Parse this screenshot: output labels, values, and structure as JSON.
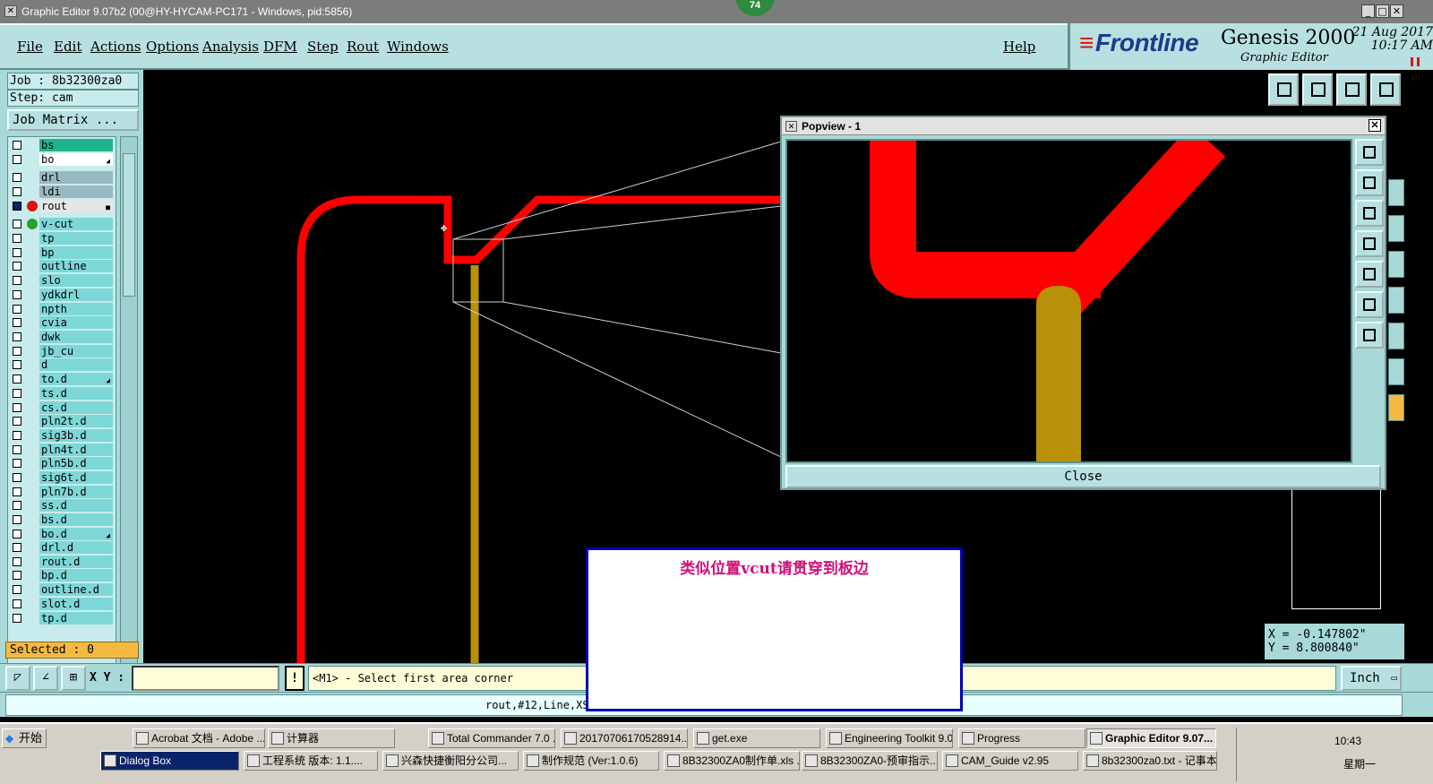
{
  "window": {
    "title": "Graphic Editor 9.07b2 (00@HY-HYCAM-PC171 - Windows, pid:5856)",
    "badge": "74"
  },
  "menu": {
    "items": [
      "File",
      "Edit",
      "Actions",
      "Options",
      "Analysis",
      "DFM",
      "Step",
      "Rout",
      "Windows"
    ],
    "help": "Help"
  },
  "brand": {
    "logo": "Frontline",
    "product": "Genesis 2000",
    "subtitle": "Graphic Editor",
    "date": "21 Aug 2017",
    "time": "10:17 AM"
  },
  "left": {
    "job": "Job : 8b32300za0",
    "step": "Step: cam",
    "job_matrix": "Job Matrix ...",
    "selected": "Selected : 0",
    "layers": [
      {
        "name": "bs",
        "color": "#1fb38a"
      },
      {
        "name": "bo",
        "color": "#ffffff",
        "mark": "◢"
      },
      {
        "name": "drl",
        "color": "#9ab8c0"
      },
      {
        "name": "ldi",
        "color": "#9ab8c0"
      },
      {
        "name": "rout",
        "color": "#e6e6e6",
        "dot": "#e01010",
        "active": true,
        "mark": "■"
      },
      {
        "name": "v-cut",
        "dot": "#2aa02a"
      },
      {
        "name": "tp"
      },
      {
        "name": "bp"
      },
      {
        "name": "outline"
      },
      {
        "name": "slo"
      },
      {
        "name": "ydkdrl"
      },
      {
        "name": "npth"
      },
      {
        "name": "cvia"
      },
      {
        "name": "dwk"
      },
      {
        "name": "jb_cu"
      },
      {
        "name": "d"
      },
      {
        "name": "to.d",
        "mark": "◢"
      },
      {
        "name": "ts.d"
      },
      {
        "name": "cs.d"
      },
      {
        "name": "pln2t.d"
      },
      {
        "name": "sig3b.d"
      },
      {
        "name": "pln4t.d"
      },
      {
        "name": "pln5b.d"
      },
      {
        "name": "sig6t.d"
      },
      {
        "name": "pln7b.d"
      },
      {
        "name": "ss.d"
      },
      {
        "name": "bs.d"
      },
      {
        "name": "bo.d",
        "mark": "◢"
      },
      {
        "name": "drl.d"
      },
      {
        "name": "rout.d"
      },
      {
        "name": "bp.d"
      },
      {
        "name": "outline.d"
      },
      {
        "name": "slot.d"
      },
      {
        "name": "tp.d"
      }
    ]
  },
  "popview": {
    "title": "Popview - 1",
    "close_label": "Close"
  },
  "coords": {
    "x": "X = -0.147802\"",
    "y": "Y = 8.800840\""
  },
  "bottom": {
    "xy_label": "X Y :",
    "xy_value": "",
    "prompt": "<M1> - Select first area corner",
    "unit": "Inch",
    "status": "rout,#12,Line,XS="
  },
  "note": {
    "text": "类似位置vcut请贯穿到板边"
  },
  "colors": {
    "rout": "#ff0000",
    "vcut": "#b8900a",
    "panel": "#a8d8d8",
    "layer_label": "#7ed7d7"
  },
  "taskbar": {
    "start": "开始",
    "row1": [
      "Acrobat 文档 - Adobe ...",
      "计算器",
      "Total Commander 7.0 ...",
      "20170706170528914....",
      "get.exe",
      "Engineering Toolkit 9.0...",
      "Progress",
      "Graphic Editor 9.07..."
    ],
    "row2": [
      "Dialog Box",
      "工程系统  版本: 1.1....",
      "兴森快捷衡阳分公司...",
      "制作规范 (Ver:1.0.6)",
      "8B32300ZA0制作单.xls ...",
      "8B32300ZA0-预审指示...",
      "CAM_Guide v2.95",
      "8b32300za0.txt - 记事本"
    ],
    "clock": "10:43",
    "weekday": "星期一"
  }
}
